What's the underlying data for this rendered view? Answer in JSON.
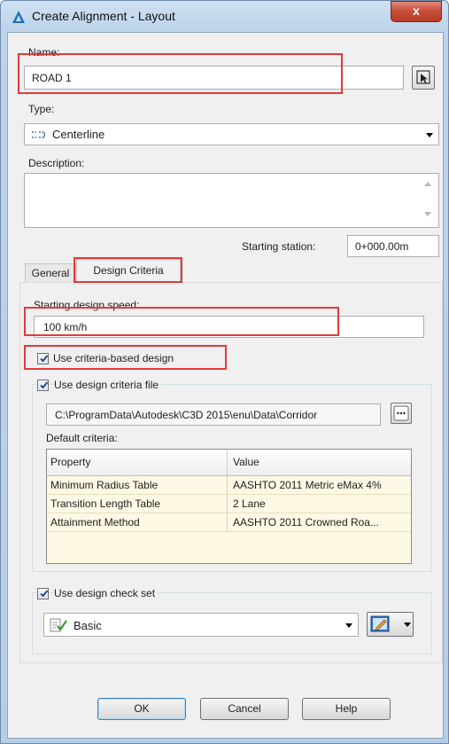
{
  "window": {
    "title": "Create Alignment - Layout",
    "close_glyph": "x"
  },
  "name": {
    "label": "Name:",
    "value": "ROAD 1"
  },
  "type": {
    "label": "Type:",
    "value": "Centerline"
  },
  "description": {
    "label": "Description:",
    "value": ""
  },
  "starting_station": {
    "label": "Starting station:",
    "value": "0+000.00m"
  },
  "tabs": [
    {
      "label": "General"
    },
    {
      "label": "Design Criteria"
    }
  ],
  "design": {
    "speed_label": "Starting design speed:",
    "speed_value": "100 km/h",
    "use_criteria_label": "Use criteria-based design",
    "use_criteria_checked": true,
    "use_file_label": "Use design criteria file",
    "use_file_checked": true,
    "file_path": "C:\\ProgramData\\Autodesk\\C3D 2015\\enu\\Data\\Corridor",
    "default_criteria_label": "Default criteria:",
    "table": {
      "headers": [
        "Property",
        "Value"
      ],
      "rows": [
        [
          "Minimum Radius Table",
          "AASHTO 2011 Metric eMax 4%"
        ],
        [
          "Transition Length Table",
          "2 Lane"
        ],
        [
          "Attainment Method",
          "AASHTO 2011 Crowned Roa..."
        ]
      ]
    },
    "use_check_set_label": "Use design check set",
    "use_check_set_checked": true,
    "check_set_value": "Basic"
  },
  "buttons": {
    "ok": "OK",
    "cancel": "Cancel",
    "help": "Help"
  },
  "colors": {
    "highlight": "#e23a3a",
    "title_gradient": "#bcd3ea",
    "grid_row": "#fdf9e4"
  }
}
